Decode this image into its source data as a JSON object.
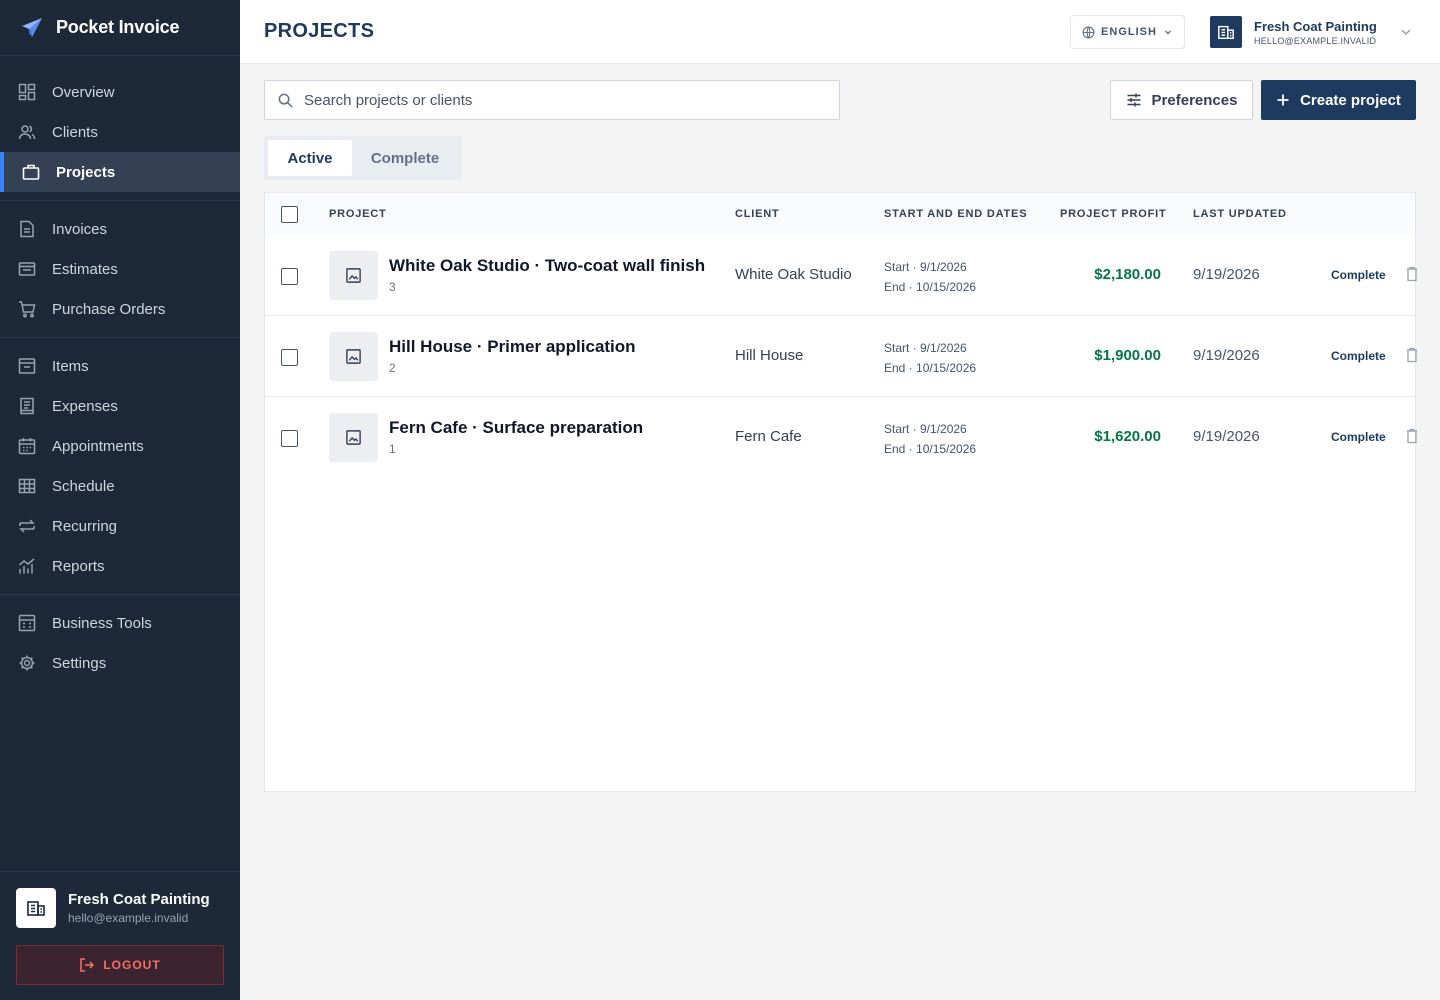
{
  "app": {
    "name": "Pocket Invoice",
    "logo_icon": "paper-plane-icon"
  },
  "sidebar": {
    "groups": [
      [
        {
          "label": "Overview",
          "icon": "grid-icon"
        },
        {
          "label": "Clients",
          "icon": "users-icon"
        },
        {
          "label": "Projects",
          "icon": "briefcase-icon",
          "active": true
        }
      ],
      [
        {
          "label": "Invoices",
          "icon": "document-icon"
        },
        {
          "label": "Estimates",
          "icon": "folder-icon"
        },
        {
          "label": "Purchase Orders",
          "icon": "cart-icon"
        }
      ],
      [
        {
          "label": "Items",
          "icon": "archive-icon"
        },
        {
          "label": "Expenses",
          "icon": "receipt-icon"
        },
        {
          "label": "Appointments",
          "icon": "calendar-icon"
        },
        {
          "label": "Schedule",
          "icon": "table-icon"
        },
        {
          "label": "Recurring",
          "icon": "repeat-icon"
        },
        {
          "label": "Reports",
          "icon": "chart-icon"
        }
      ],
      [
        {
          "label": "Business Tools",
          "icon": "calculator-icon"
        },
        {
          "label": "Settings",
          "icon": "gear-icon"
        }
      ]
    ],
    "account": {
      "name": "Fresh Coat Painting",
      "email": "hello@example.invalid"
    },
    "logout_label": "LOGOUT"
  },
  "header": {
    "title": "PROJECTS",
    "language": "ENGLISH",
    "business_name": "Fresh Coat Painting",
    "business_email": "HELLO@EXAMPLE.INVALID"
  },
  "toolbar": {
    "search_placeholder": "Search projects or clients",
    "preferences_label": "Preferences",
    "create_label": "Create project"
  },
  "tabs": [
    {
      "label": "Active",
      "active": true
    },
    {
      "label": "Complete",
      "active": false
    }
  ],
  "table": {
    "columns": {
      "project": "PROJECT",
      "client": "CLIENT",
      "dates": "START AND END DATES",
      "profit": "PROJECT PROFIT",
      "updated": "LAST UPDATED"
    },
    "rows": [
      {
        "name": "White Oak Studio · Two-coat wall finish",
        "count": "3",
        "client": "White Oak Studio",
        "start": "Start · 9/1/2026",
        "end": "End · 10/15/2026",
        "profit": "$2,180.00",
        "updated": "9/19/2026",
        "action": "Complete"
      },
      {
        "name": "Hill House · Primer application",
        "count": "2",
        "client": "Hill House",
        "start": "Start · 9/1/2026",
        "end": "End · 10/15/2026",
        "profit": "$1,900.00",
        "updated": "9/19/2026",
        "action": "Complete"
      },
      {
        "name": "Fern Cafe · Surface preparation",
        "count": "1",
        "client": "Fern Cafe",
        "start": "Start · 9/1/2026",
        "end": "End · 10/15/2026",
        "profit": "$1,620.00",
        "updated": "9/19/2026",
        "action": "Complete"
      }
    ]
  },
  "colors": {
    "sidebar_bg": "#1d2939",
    "brand_navy": "#1e3a5f",
    "profit_green": "#067647",
    "logout_red": "#f97066",
    "active_indicator": "#3b82f6"
  }
}
